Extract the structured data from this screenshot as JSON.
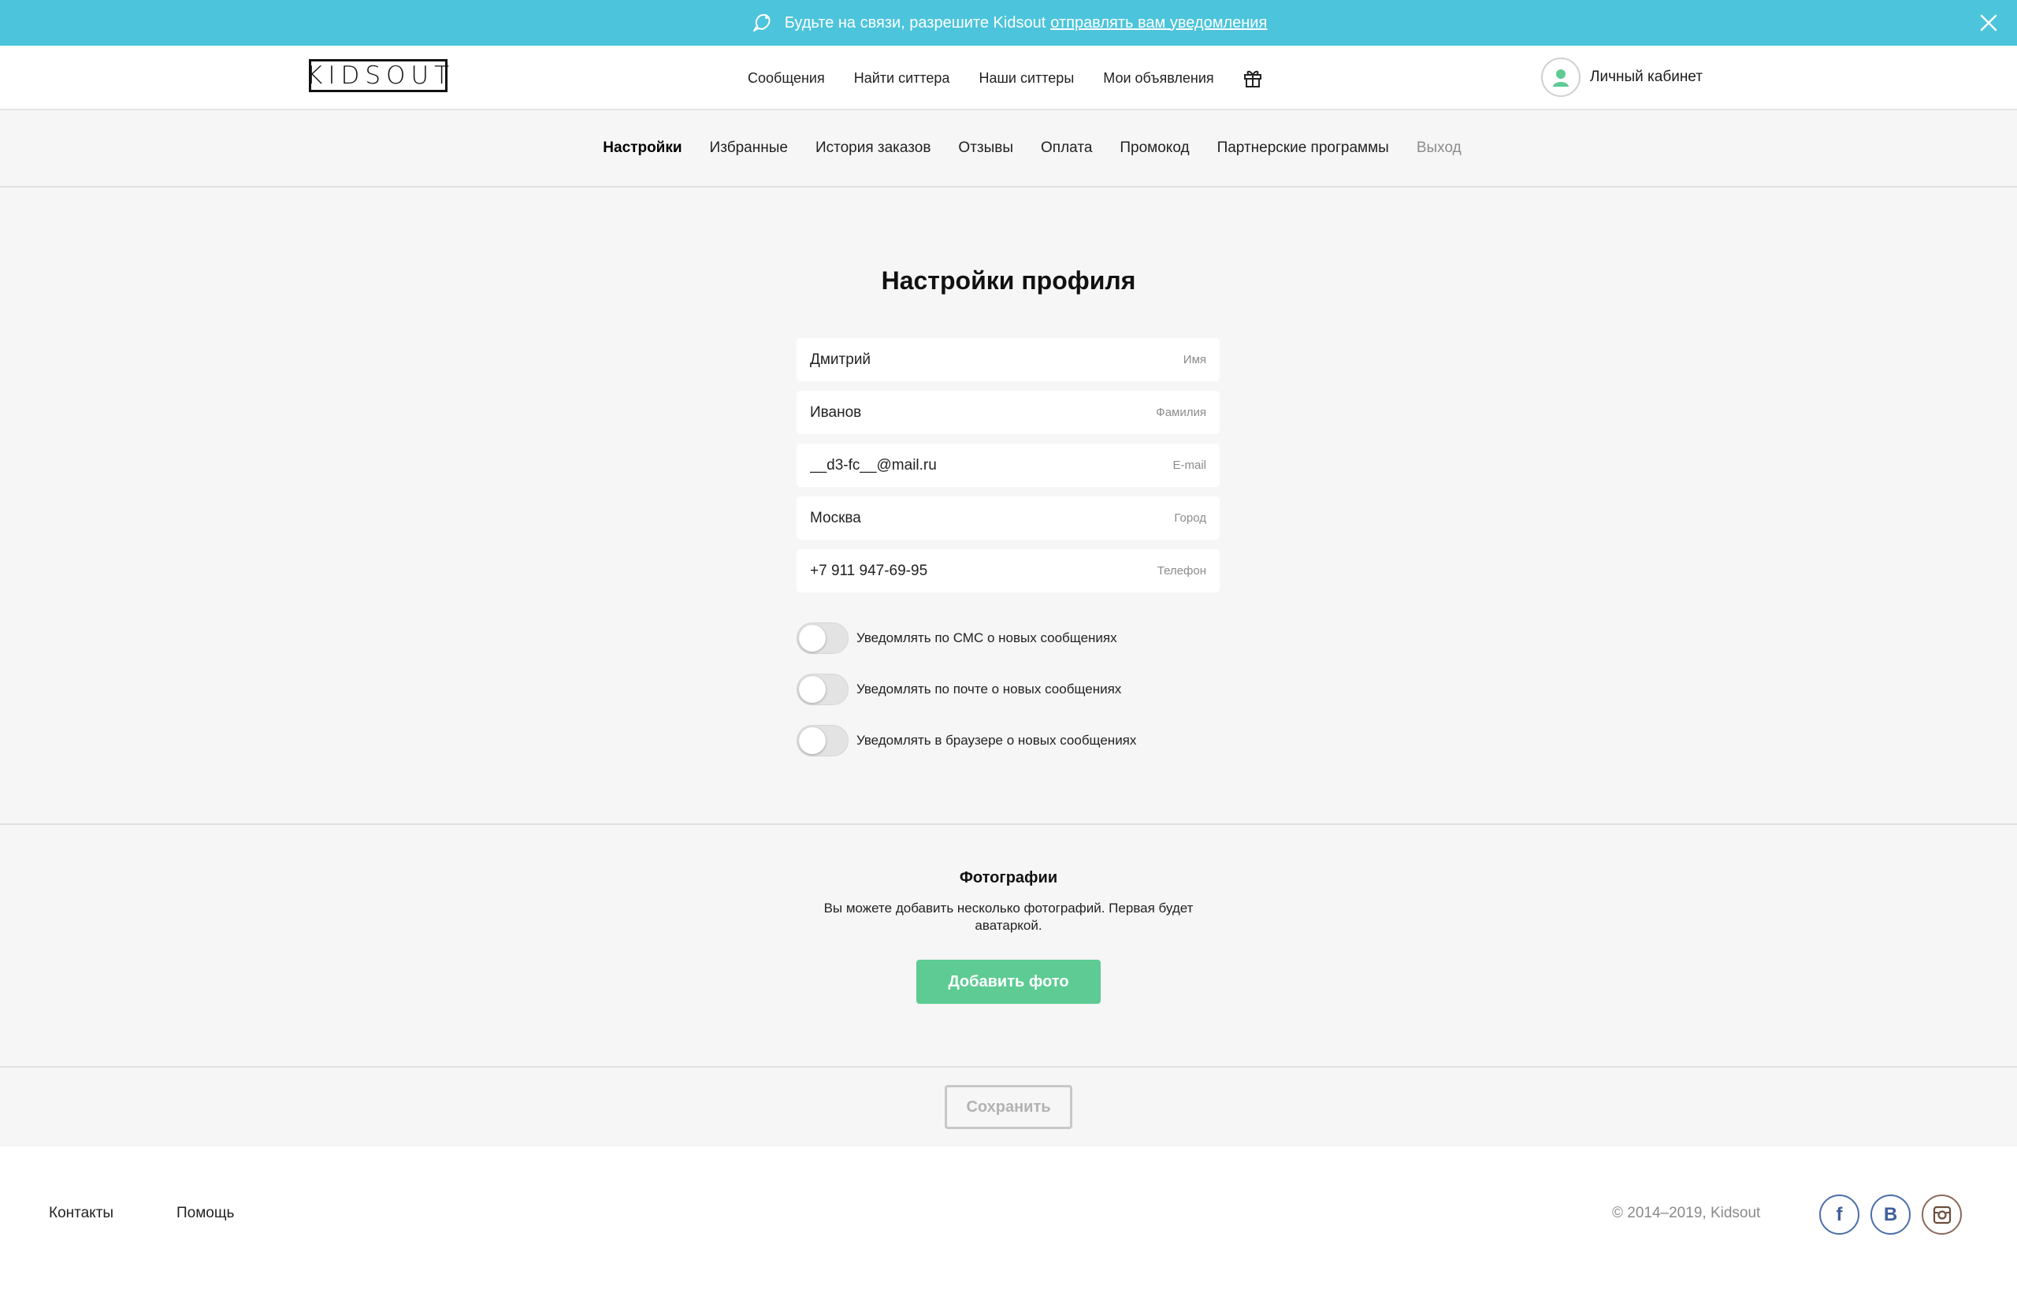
{
  "banner": {
    "text": "Будьте на связи, разрешите Kidsout",
    "link": "отправлять вам уведомления"
  },
  "header": {
    "logo": "KIDSOUT",
    "nav": [
      "Сообщения",
      "Найти ситтера",
      "Наши ситтеры",
      "Мои объявления"
    ],
    "cabinet": "Личный кабинет"
  },
  "subnav": {
    "items": [
      "Настройки",
      "Избранные",
      "История заказов",
      "Отзывы",
      "Оплата",
      "Промокод",
      "Партнерские программы"
    ],
    "logout": "Выход"
  },
  "settings": {
    "title": "Настройки профиля",
    "fields": [
      {
        "value": "Дмитрий",
        "hint": "Имя"
      },
      {
        "value": "Иванов",
        "hint": "Фамилия"
      },
      {
        "value": "__d3-fc__@mail.ru",
        "hint": "E-mail"
      },
      {
        "value": "Москва",
        "hint": "Город"
      },
      {
        "value": "+7 911 947-69-95",
        "hint": "Телефон"
      }
    ],
    "toggles": [
      {
        "label": "Уведомлять по СМС о новых сообщениях",
        "on": false
      },
      {
        "label": "Уведомлять по почте о новых сообщениях",
        "on": false
      },
      {
        "label": "Уведомлять в браузере о новых сообщениях",
        "on": false
      }
    ]
  },
  "photos": {
    "title": "Фотографии",
    "description": "Вы можете добавить несколько фотографий. Первая будет аватаркой.",
    "add_button": "Добавить фото"
  },
  "save_button": "Сохранить",
  "footer": {
    "contacts": "Контакты",
    "help": "Помощь",
    "copyright": "© 2014–2019, Kidsout",
    "social": [
      "f",
      "В"
    ]
  },
  "colors": {
    "banner": "#4cc4dc",
    "accent_green": "#5dcb93",
    "background": "#f6f6f6"
  }
}
